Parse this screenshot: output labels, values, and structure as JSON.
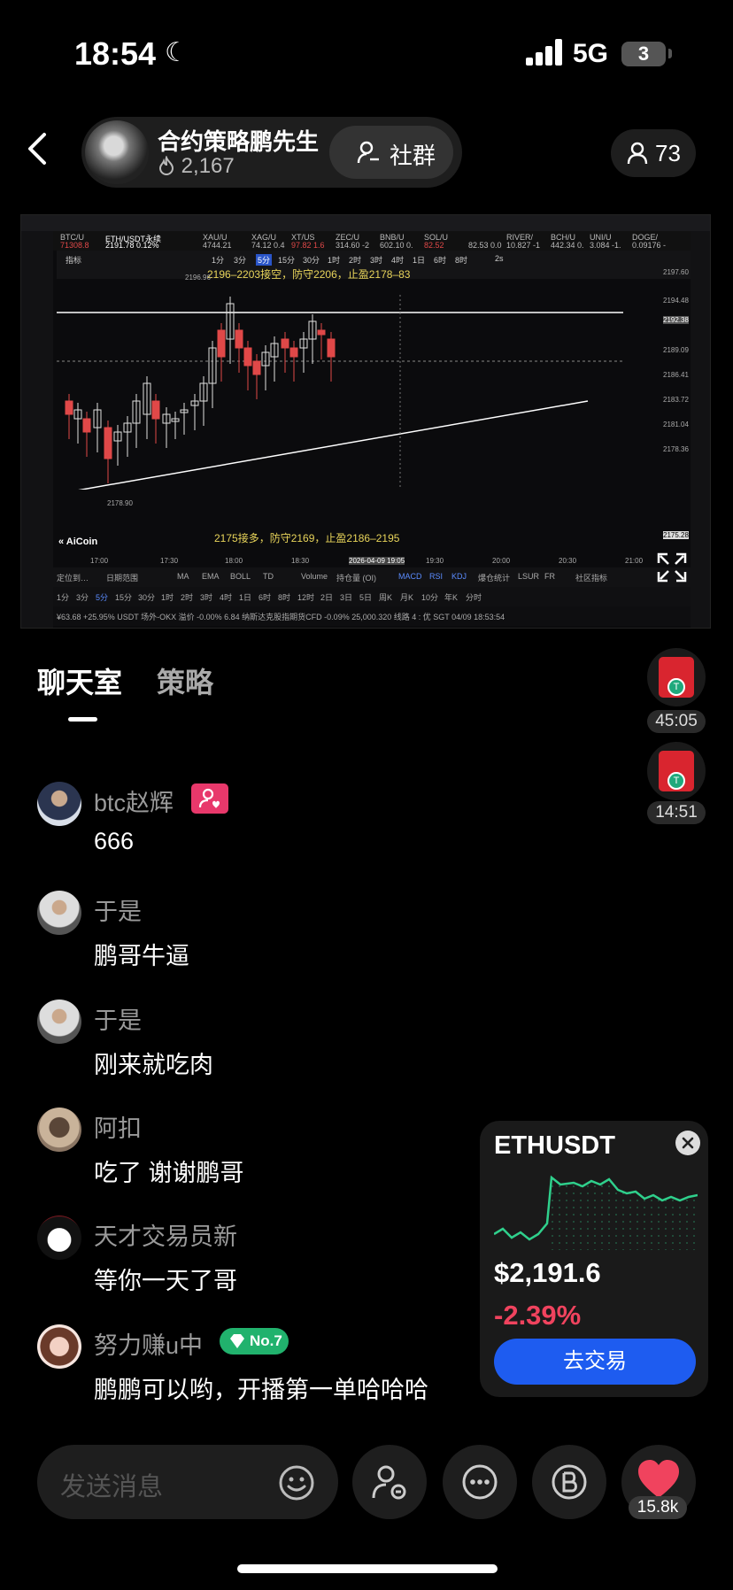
{
  "status_bar": {
    "time": "18:54",
    "network": "5G",
    "battery": "3"
  },
  "header": {
    "host_name": "合约策略鹏先生",
    "host_fans": "2,167",
    "community_label": "社群",
    "viewer_count": "73"
  },
  "stream_screen": {
    "toolbar_tickers": [
      "BTC/U",
      "ETH/USDT永续",
      "XAU/U",
      "XAG/U",
      "XT/US",
      "ZEC/U",
      "BNB/U",
      "SOL/U",
      "RIVER/",
      "BCH/U",
      "UNI/U",
      "DOGE/"
    ],
    "ticker_values": [
      "71308.8",
      "2191.78 0.12%",
      "4744.21",
      "74.12 0.4",
      "97.82 1.6",
      "314.60 -2",
      "602.10 0.",
      "82.52",
      "82.53 0.0",
      "10.827 -1",
      "442.34 0.",
      "3.084 -1.",
      "0.09176 -"
    ],
    "tabs_row": [
      "指标",
      "1分",
      "3分",
      "5分",
      "15分",
      "30分",
      "1时",
      "2时",
      "3时",
      "4时",
      "1日",
      "6时",
      "8时",
      "2s"
    ],
    "level_short": "2196–2203接空，防守2206，止盈2178–83",
    "level_long": "2175接多，防守2169，止盈2186–2195",
    "high_label": "2196.96",
    "low_label": "2178.90",
    "price_axis": [
      "2197.60",
      "2194.48",
      "2192.38",
      "2189.09",
      "2186.41",
      "2183.72",
      "2181.04",
      "2178.36",
      "2175.28"
    ],
    "time_axis": [
      "17:00",
      "17:30",
      "18:00",
      "18:30",
      "2026-04-09 19:05",
      "19:30",
      "20:00",
      "20:30",
      "21:00"
    ],
    "logo": "AiCoin",
    "indicator_row": [
      "定位到…",
      "日期范围",
      "MA",
      "EMA",
      "BOLL",
      "TD",
      "Volume",
      "持仓量 (OI)",
      "MACD",
      "RSI",
      "KDJ",
      "爆仓统计",
      "LSUR",
      "FR",
      "社区指标"
    ],
    "period_row": [
      "1分",
      "3分",
      "5分",
      "15分",
      "30分",
      "1时",
      "2时",
      "3时",
      "4时",
      "1日",
      "6时",
      "8时",
      "12时",
      "2日",
      "3日",
      "5日",
      "周K",
      "月K",
      "10分",
      "年K",
      "分时"
    ],
    "footer": "¥63.68  +25.95%     USDT 场外-OKX  溢价 -0.00%  6.84     纳斯达克股指期货CFD  -0.09%  25,000.320        线路 4 : 优     SGT 04/09 18:53:54"
  },
  "chat_tabs": {
    "active": "聊天室",
    "inactive": "策略"
  },
  "red_packets": [
    {
      "time": "45:05"
    },
    {
      "time": "14:51"
    }
  ],
  "messages": [
    {
      "name": "btc赵辉",
      "text": "666",
      "badge": "heart"
    },
    {
      "name": "于是",
      "text": "鹏哥牛逼"
    },
    {
      "name": "于是",
      "text": "刚来就吃肉"
    },
    {
      "name": "阿扣",
      "text": "吃了 谢谢鹏哥"
    },
    {
      "name": "天才交易员新",
      "text": "等你一天了哥"
    },
    {
      "name": "努力赚u中",
      "text": "鹏鹏可以哟，开播第一单哈哈哈",
      "badge": "No.7"
    }
  ],
  "ticker_card": {
    "symbol": "ETHUSDT",
    "price": "$2,191.6",
    "change": "-2.39%",
    "button": "去交易",
    "accent": "#2fd08c"
  },
  "bottom_bar": {
    "placeholder": "发送消息",
    "likes": "15.8k"
  },
  "colors": {
    "up": "#e0e0e0",
    "down": "#e04848",
    "brand_blue": "#1e5cf0",
    "like_red": "#f0435e"
  }
}
